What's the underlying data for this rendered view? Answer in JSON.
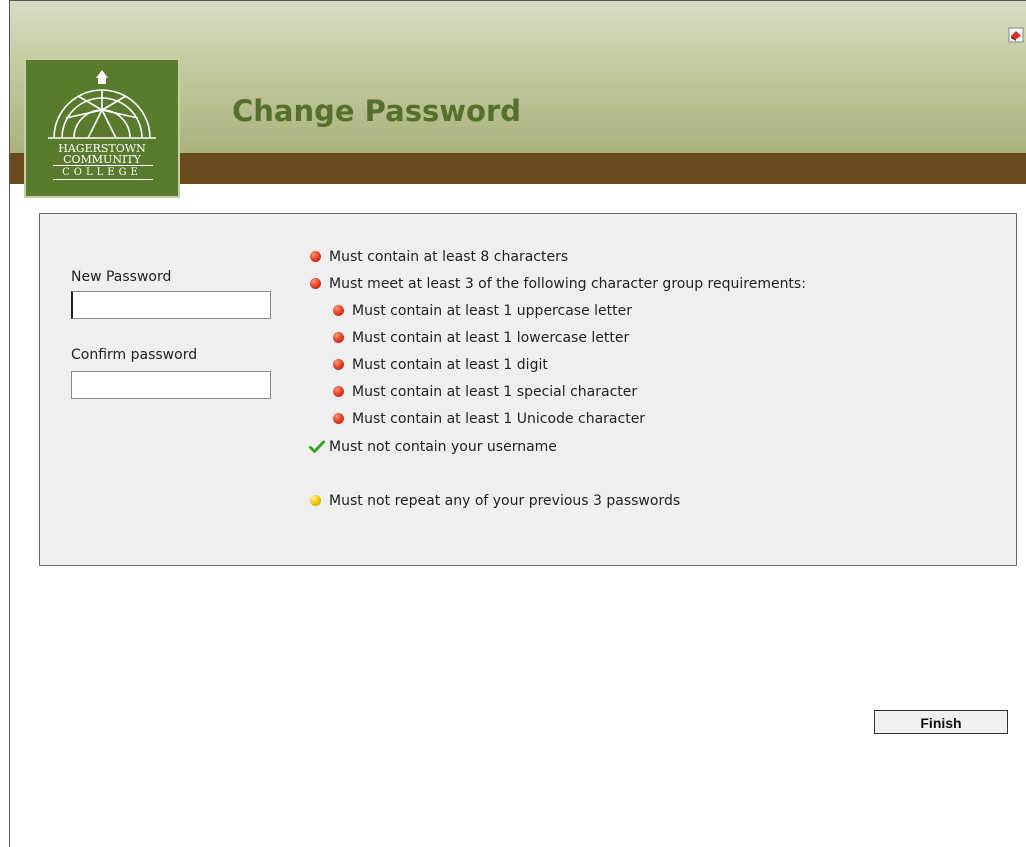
{
  "header": {
    "title": "Change Password",
    "logo": {
      "line1": "HAGERSTOWN",
      "line2": "COMMUNITY",
      "line3": "COLLEGE"
    },
    "corner_icon": "help-book-icon"
  },
  "form": {
    "new_password_label": "New Password",
    "new_password_value": "",
    "confirm_password_label": "Confirm password",
    "confirm_password_value": ""
  },
  "requirements": [
    {
      "text": "Must contain at least 8 characters",
      "status": "fail",
      "level": 0
    },
    {
      "text": "Must meet at least 3 of the following character group requirements:",
      "status": "fail",
      "level": 0
    },
    {
      "text": "Must contain at least 1 uppercase letter",
      "status": "fail",
      "level": 1
    },
    {
      "text": "Must contain at least 1 lowercase letter",
      "status": "fail",
      "level": 1
    },
    {
      "text": "Must contain at least 1 digit",
      "status": "fail",
      "level": 1
    },
    {
      "text": "Must contain at least 1 special character",
      "status": "fail",
      "level": 1
    },
    {
      "text": "Must contain at least 1 Unicode character",
      "status": "fail",
      "level": 1
    },
    {
      "text": "Must not contain your username",
      "status": "pass",
      "level": 0
    },
    {
      "text": "Must not repeat any of your previous 3 passwords",
      "status": "pending",
      "level": 0
    }
  ],
  "status_colors": {
    "fail": "#e8452a",
    "pass": "#3aa12a",
    "pending": "#f2c800"
  },
  "buttons": {
    "finish_label": "Finish"
  }
}
